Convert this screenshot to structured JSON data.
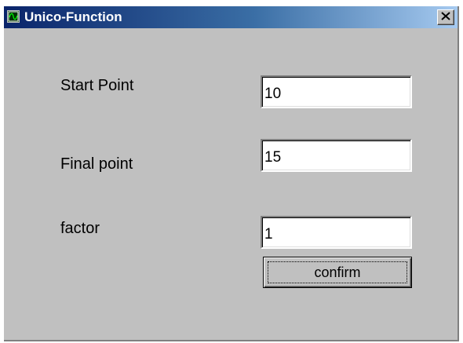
{
  "window": {
    "title": "Unico-Function",
    "icon": "function-graph-icon",
    "close_icon": "close-icon"
  },
  "form": {
    "start_point": {
      "label": "Start Point",
      "value": "10"
    },
    "final_point": {
      "label": "Final point",
      "value": "15"
    },
    "factor": {
      "label": "factor",
      "value": "1"
    },
    "confirm_label": "confirm"
  },
  "colors": {
    "titlebar_start": "#0a246a",
    "titlebar_end": "#a6caf0",
    "window_bg": "#c0c0c0"
  }
}
